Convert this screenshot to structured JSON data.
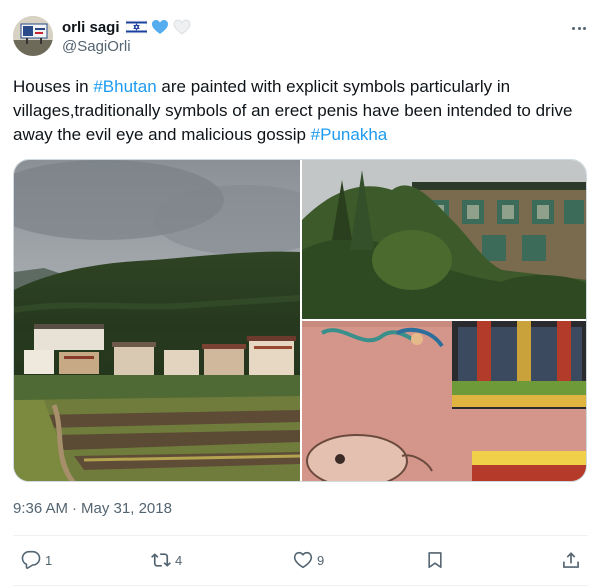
{
  "author": {
    "display_name": "orli sagi",
    "handle": "@SagiOrli",
    "flag_icon": "israel-flag-icon",
    "emoji_icons": [
      "blue-heart-icon",
      "white-heart-icon"
    ]
  },
  "tweet": {
    "text_parts": [
      {
        "t": "Houses in ",
        "tag": false
      },
      {
        "t": "#Bhutan",
        "tag": true
      },
      {
        "t": " are painted with explicit symbols particularly in villages,traditionally symbols of an erect penis have been intended to drive away the evil eye and malicious gossip ",
        "tag": false
      },
      {
        "t": "#Punakha",
        "tag": true
      }
    ],
    "time": "9:36 AM",
    "separator": "·",
    "date": "May 31, 2018"
  },
  "media": {
    "images": [
      "bhutan-village-hillside-photo",
      "green-house-trees-photo",
      "painted-wall-phallus-photo"
    ]
  },
  "actions": {
    "reply_count": "1",
    "retweet_count": "4",
    "like_count": "9",
    "bookmark_label": "",
    "share_label": ""
  },
  "colors": {
    "link": "#1d9bf0",
    "secondary_text": "#536471",
    "border": "#cfd9de"
  }
}
